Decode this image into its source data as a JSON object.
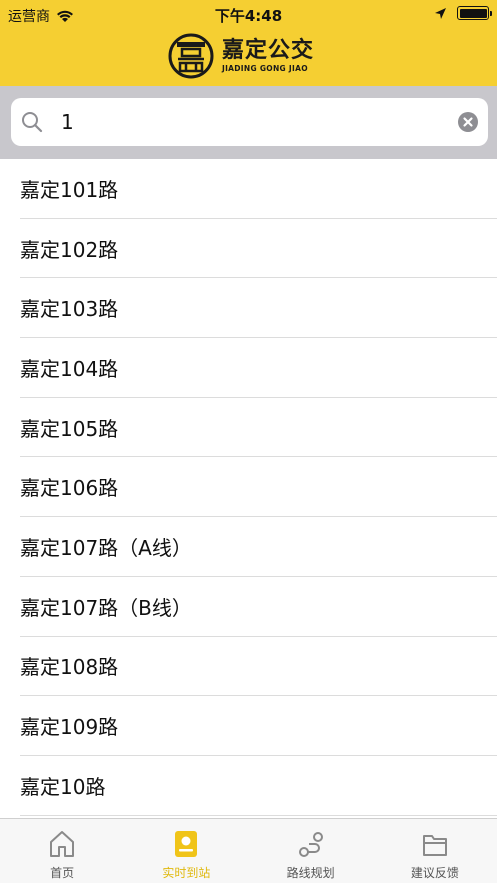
{
  "status_bar": {
    "carrier": "运营商",
    "time": "下午4:48"
  },
  "logo": {
    "chinese": "嘉定公交",
    "english": "JIADING GONG JIAO"
  },
  "search": {
    "value": "1"
  },
  "routes": [
    "嘉定101路",
    "嘉定102路",
    "嘉定103路",
    "嘉定104路",
    "嘉定105路",
    "嘉定106路",
    "嘉定107路（A线）",
    "嘉定107路（B线）",
    "嘉定108路",
    "嘉定109路",
    "嘉定10路"
  ],
  "tabs": [
    {
      "label": "首页",
      "icon": "home-icon"
    },
    {
      "label": "实时到站",
      "icon": "realtime-arrival-icon",
      "active": true
    },
    {
      "label": "路线规划",
      "icon": "route-planning-icon"
    },
    {
      "label": "建议反馈",
      "icon": "feedback-folder-icon"
    }
  ],
  "colors": {
    "brand": "#f5cf32",
    "active_tab": "#e0b90e"
  }
}
